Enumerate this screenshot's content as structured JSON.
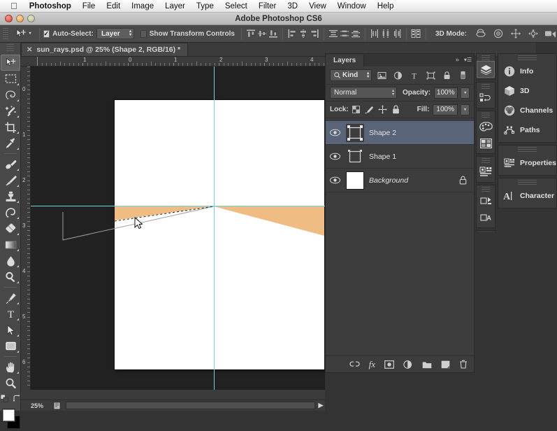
{
  "os_menu": {
    "apple_icon": "apple-logo-icon",
    "items": [
      {
        "label": "Photoshop",
        "bold": true
      },
      {
        "label": "File",
        "bold": false
      },
      {
        "label": "Edit",
        "bold": false
      },
      {
        "label": "Image",
        "bold": false
      },
      {
        "label": "Layer",
        "bold": false
      },
      {
        "label": "Type",
        "bold": false
      },
      {
        "label": "Select",
        "bold": false
      },
      {
        "label": "Filter",
        "bold": false
      },
      {
        "label": "3D",
        "bold": false
      },
      {
        "label": "View",
        "bold": false
      },
      {
        "label": "Window",
        "bold": false
      },
      {
        "label": "Help",
        "bold": false
      }
    ]
  },
  "titlebar": {
    "title": "Adobe Photoshop CS6",
    "close_button": "close-button",
    "minimize_button": "minimize-button",
    "zoom_button": "zoom-button"
  },
  "options_bar": {
    "tool_icon": "move-tool-icon",
    "auto_select_checked": true,
    "auto_select_label": "Auto-Select:",
    "auto_select_value": "Layer",
    "show_transform_checked": false,
    "show_transform_label": "Show Transform Controls",
    "align_buttons": [
      "align-top-edges",
      "align-vertical-centers",
      "align-bottom-edges",
      "align-left-edges",
      "align-horizontal-centers",
      "align-right-edges"
    ],
    "distribute_buttons": [
      "distribute-top-edges",
      "distribute-vertical-centers",
      "distribute-bottom-edges",
      "distribute-left-edges",
      "distribute-horizontal-centers",
      "distribute-right-edges"
    ],
    "auto_align_button": "auto-align-layers",
    "mode_3d_label": "3D Mode:",
    "mode_3d_buttons": [
      "rotate-3d-object",
      "roll-3d-object",
      "drag-3d-object",
      "slide-3d-object",
      "scale-3d-object"
    ]
  },
  "document": {
    "tab_title": "sun_rays.psd @ 25% (Shape 2, RGB/16) *",
    "close_icon": "close-icon",
    "zoom_level": "25%",
    "ruler_h_labels": [
      "1",
      "0",
      "1",
      "2",
      "3",
      "4"
    ],
    "ruler_v_labels": [
      "0",
      "1",
      "2",
      "3",
      "4",
      "5",
      "6"
    ],
    "doc_info_icon": "document-info-icon",
    "scroll_right_arrow": "scroll-right-arrow"
  },
  "canvas": {
    "paper_color": "#ffffff",
    "shape_color": "#efbc83",
    "guide_color": "#6fd4e6",
    "background_color": "#212121",
    "cursor": "move-cursor"
  },
  "tools": [
    {
      "name": "move-tool",
      "selected": true,
      "has_flyout": false
    },
    {
      "name": "rectangular-marquee-tool",
      "selected": false,
      "has_flyout": true
    },
    {
      "name": "lasso-tool",
      "selected": false,
      "has_flyout": true
    },
    {
      "name": "quick-selection-tool",
      "selected": false,
      "has_flyout": true
    },
    {
      "name": "crop-tool",
      "selected": false,
      "has_flyout": true
    },
    {
      "name": "eyedropper-tool",
      "selected": false,
      "has_flyout": true
    },
    {
      "name": "spot-healing-brush-tool",
      "selected": false,
      "has_flyout": true
    },
    {
      "name": "brush-tool",
      "selected": false,
      "has_flyout": true
    },
    {
      "name": "clone-stamp-tool",
      "selected": false,
      "has_flyout": true
    },
    {
      "name": "history-brush-tool",
      "selected": false,
      "has_flyout": true
    },
    {
      "name": "eraser-tool",
      "selected": false,
      "has_flyout": true
    },
    {
      "name": "gradient-tool",
      "selected": false,
      "has_flyout": true
    },
    {
      "name": "blur-tool",
      "selected": false,
      "has_flyout": true
    },
    {
      "name": "dodge-tool",
      "selected": false,
      "has_flyout": true
    },
    {
      "name": "pen-tool",
      "selected": false,
      "has_flyout": true
    },
    {
      "name": "horizontal-type-tool",
      "selected": false,
      "has_flyout": true
    },
    {
      "name": "path-selection-tool",
      "selected": false,
      "has_flyout": true
    },
    {
      "name": "rectangle-tool",
      "selected": false,
      "has_flyout": true
    },
    {
      "name": "hand-tool",
      "selected": false,
      "has_flyout": true
    },
    {
      "name": "zoom-tool",
      "selected": false,
      "has_flyout": false
    }
  ],
  "tool_extras": {
    "default_colors_icon": "default-foreground-background-colors",
    "swap_colors_icon": "swap-foreground-background-colors",
    "foreground_color": "#ffffff",
    "background_color": "#000000"
  },
  "layers_panel": {
    "tab_label": "Layers",
    "collapse_icon": "collapse-to-icons-icon",
    "menu_icon": "panel-menu-icon",
    "filter_label": "Kind",
    "filter_search_icon": "search-icon",
    "filter_type_icons": [
      "filter-pixel-layers",
      "filter-adjustment-layers",
      "filter-type-layers",
      "filter-shape-layers",
      "filter-smart-objects"
    ],
    "filter_toggle_icon": "filter-enable-toggle",
    "blend_mode": "Normal",
    "opacity_label": "Opacity:",
    "opacity_value": "100%",
    "lock_label": "Lock:",
    "lock_icons": [
      "lock-transparent-pixels",
      "lock-image-pixels",
      "lock-position",
      "lock-all"
    ],
    "fill_label": "Fill:",
    "fill_value": "100%",
    "layers": [
      {
        "name": "Shape 2",
        "visible": true,
        "selected": true,
        "thumb": "vector-mask-thumbnail",
        "locked": false,
        "italic": false
      },
      {
        "name": "Shape 1",
        "visible": true,
        "selected": false,
        "thumb": "vector-mask-thumbnail",
        "locked": false,
        "italic": false
      },
      {
        "name": "Background",
        "visible": true,
        "selected": false,
        "thumb": "white-fill-thumbnail",
        "locked": true,
        "italic": true
      }
    ],
    "bottom_buttons": [
      "link-layers-icon",
      "add-layer-style-icon",
      "add-layer-mask-icon",
      "new-adjustment-layer-icon",
      "new-group-icon",
      "new-layer-icon",
      "delete-layer-icon"
    ]
  },
  "icon_dock": [
    {
      "items": [
        {
          "name": "layers-panel-icon",
          "active": true
        }
      ]
    },
    {
      "items": [
        {
          "name": "history-panel-icon",
          "active": false
        }
      ]
    },
    {
      "items": [
        {
          "name": "color-panel-icon",
          "active": false
        },
        {
          "name": "swatches-panel-icon",
          "active": false
        }
      ]
    },
    {
      "items": [
        {
          "name": "adjustments-panel-icon",
          "active": false
        }
      ]
    },
    {
      "items": [
        {
          "name": "layer-comps-panel-icon",
          "active": false
        },
        {
          "name": "paragraph-styles-panel-icon",
          "active": false
        }
      ]
    },
    {
      "items": [
        {
          "name": "masks-panel-icon",
          "active": false
        }
      ]
    }
  ],
  "right_dock": [
    {
      "items": [
        {
          "label": "Info",
          "icon": "info-panel-icon"
        },
        {
          "label": "3D",
          "icon": "3d-panel-icon"
        },
        {
          "label": "Channels",
          "icon": "channels-panel-icon"
        },
        {
          "label": "Paths",
          "icon": "paths-panel-icon"
        }
      ]
    },
    {
      "items": [
        {
          "label": "Properties",
          "icon": "properties-panel-icon"
        }
      ]
    },
    {
      "items": [
        {
          "label": "Character",
          "icon": "character-panel-icon"
        }
      ]
    }
  ]
}
